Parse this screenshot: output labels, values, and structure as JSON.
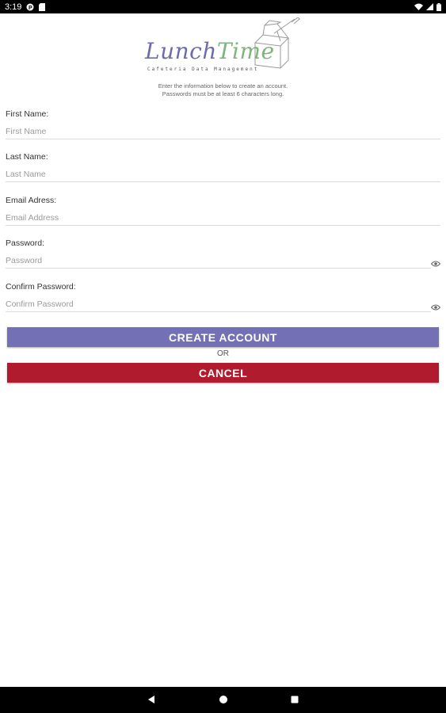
{
  "status_bar": {
    "time": "3:19",
    "left_icons": [
      "notification-app-icon",
      "sd-card-icon"
    ],
    "right_icons": [
      "wifi-icon",
      "signal-icon",
      "battery-icon"
    ]
  },
  "logo": {
    "word1": "Lunch",
    "word2": "Time",
    "tagline": "Cafeteria Data Management",
    "colors": {
      "lunch": "#6f6ab0",
      "time": "#7db57a"
    }
  },
  "intro": {
    "line1": "Enter the information below to create an account.",
    "line2": "Passwords must be at least 6 characters long."
  },
  "form": {
    "first_name": {
      "label": "First Name:",
      "placeholder": "First Name"
    },
    "last_name": {
      "label": "Last Name:",
      "placeholder": "Last Name"
    },
    "email": {
      "label": "Email Adress:",
      "placeholder": "Email Address"
    },
    "password": {
      "label": "Password:",
      "placeholder": "Password",
      "icon": "eye-icon"
    },
    "confirm_password": {
      "label": "Confirm Password:",
      "placeholder": "Confirm Password",
      "icon": "eye-icon"
    }
  },
  "buttons": {
    "create_label": "CREATE ACCOUNT",
    "or_label": "OR",
    "cancel_label": "CANCEL",
    "colors": {
      "create": "#7370b5",
      "cancel": "#b01c2e"
    }
  },
  "nav_bar": {
    "icons": [
      "back-icon",
      "home-icon",
      "recents-icon"
    ]
  }
}
